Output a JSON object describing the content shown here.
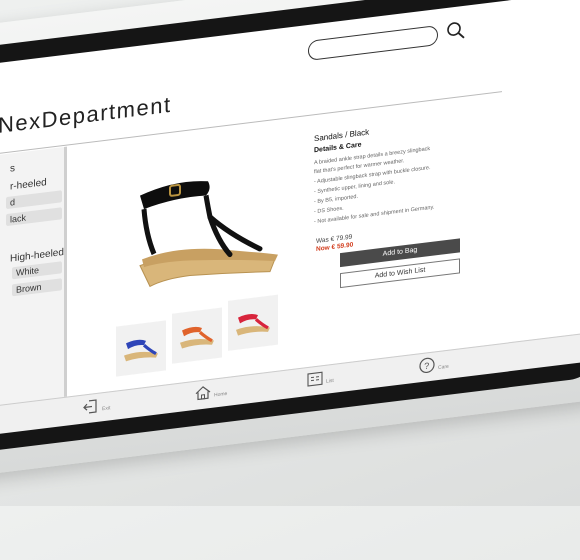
{
  "app": {
    "brand": "NexDepartment"
  },
  "search": {
    "placeholder": ""
  },
  "sidebar": {
    "fragment_top": "s",
    "groups": [
      {
        "heading": "r-heeled",
        "chips": [
          "d",
          "lack"
        ]
      },
      {
        "heading": "High-heeled",
        "chips": [
          "White",
          "Brown"
        ]
      }
    ]
  },
  "product": {
    "title": "Sandals / Black",
    "details_heading": "Details & Care",
    "description_lines": [
      "A braided ankle strap details a breezy slingback",
      "flat that's perfect for warmer weather.",
      "- Adjustable slingback strap with buckle closure.",
      "- Synthetic upper, lining and sole.",
      "- By B5, imported.",
      "- DS Shoes.",
      "- Not available for sale and shipment in Germany."
    ],
    "price_was": "Was € 79.99",
    "price_now": "Now € 59.90",
    "thumbnails": [
      "blue",
      "orange",
      "red"
    ]
  },
  "actions": {
    "add_to_bag": "Add to Bag",
    "add_to_wishlist": "Add to Wish List"
  },
  "bottom_nav": {
    "exit": "Exit",
    "home": "Home",
    "list": "List",
    "care": "Care"
  },
  "colors": {
    "accent_price": "#d23c1c",
    "primary_button": "#4a4a4a",
    "thumb_blue": "#2e45b8",
    "thumb_orange": "#e0632c",
    "thumb_red": "#d8243c"
  }
}
